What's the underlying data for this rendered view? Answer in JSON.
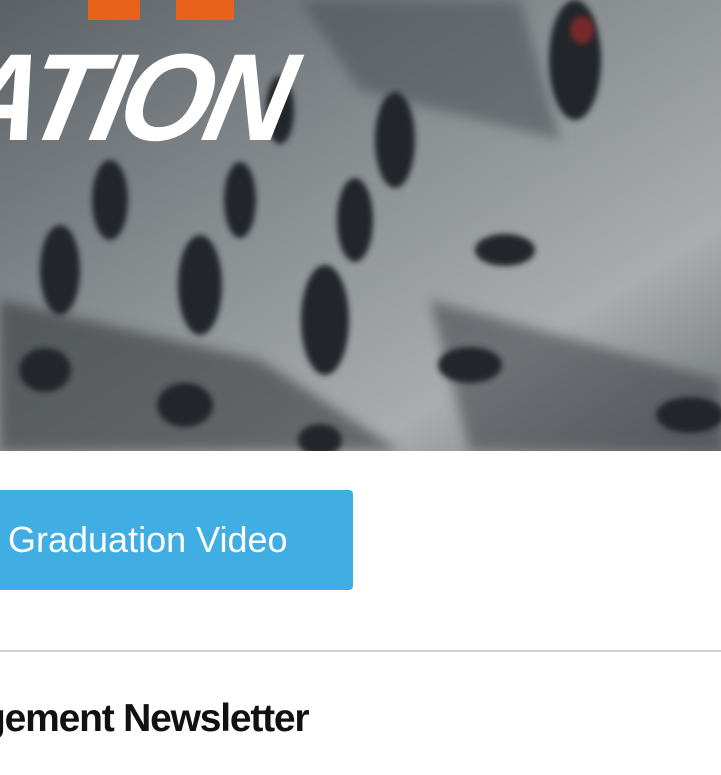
{
  "hero": {
    "image": "graduation-parade-photo",
    "wordmark_text": "ATION",
    "accent_color": "#e8621a"
  },
  "cta": {
    "label": "Graduation Video",
    "color": "#40aee3"
  },
  "section": {
    "heading": "gement Newsletter"
  }
}
